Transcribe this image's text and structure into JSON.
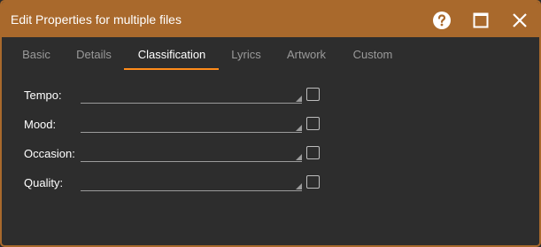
{
  "window": {
    "title": "Edit Properties for multiple files",
    "accent_color": "#a9692c",
    "background_color": "#2d2d2d",
    "controls": {
      "help_icon": "help-circle-icon",
      "maximize_icon": "maximize-icon",
      "close_icon": "close-icon"
    }
  },
  "tabs": [
    {
      "label": "Basic",
      "active": false
    },
    {
      "label": "Details",
      "active": false
    },
    {
      "label": "Classification",
      "active": true
    },
    {
      "label": "Lyrics",
      "active": false
    },
    {
      "label": "Artwork",
      "active": false
    },
    {
      "label": "Custom",
      "active": false
    }
  ],
  "active_tab_color": "#ff8c1a",
  "fields": [
    {
      "label": "Tempo:",
      "value": "",
      "checked": false
    },
    {
      "label": "Mood:",
      "value": "",
      "checked": false
    },
    {
      "label": "Occasion:",
      "value": "",
      "checked": false
    },
    {
      "label": "Quality:",
      "value": "",
      "checked": false
    }
  ]
}
